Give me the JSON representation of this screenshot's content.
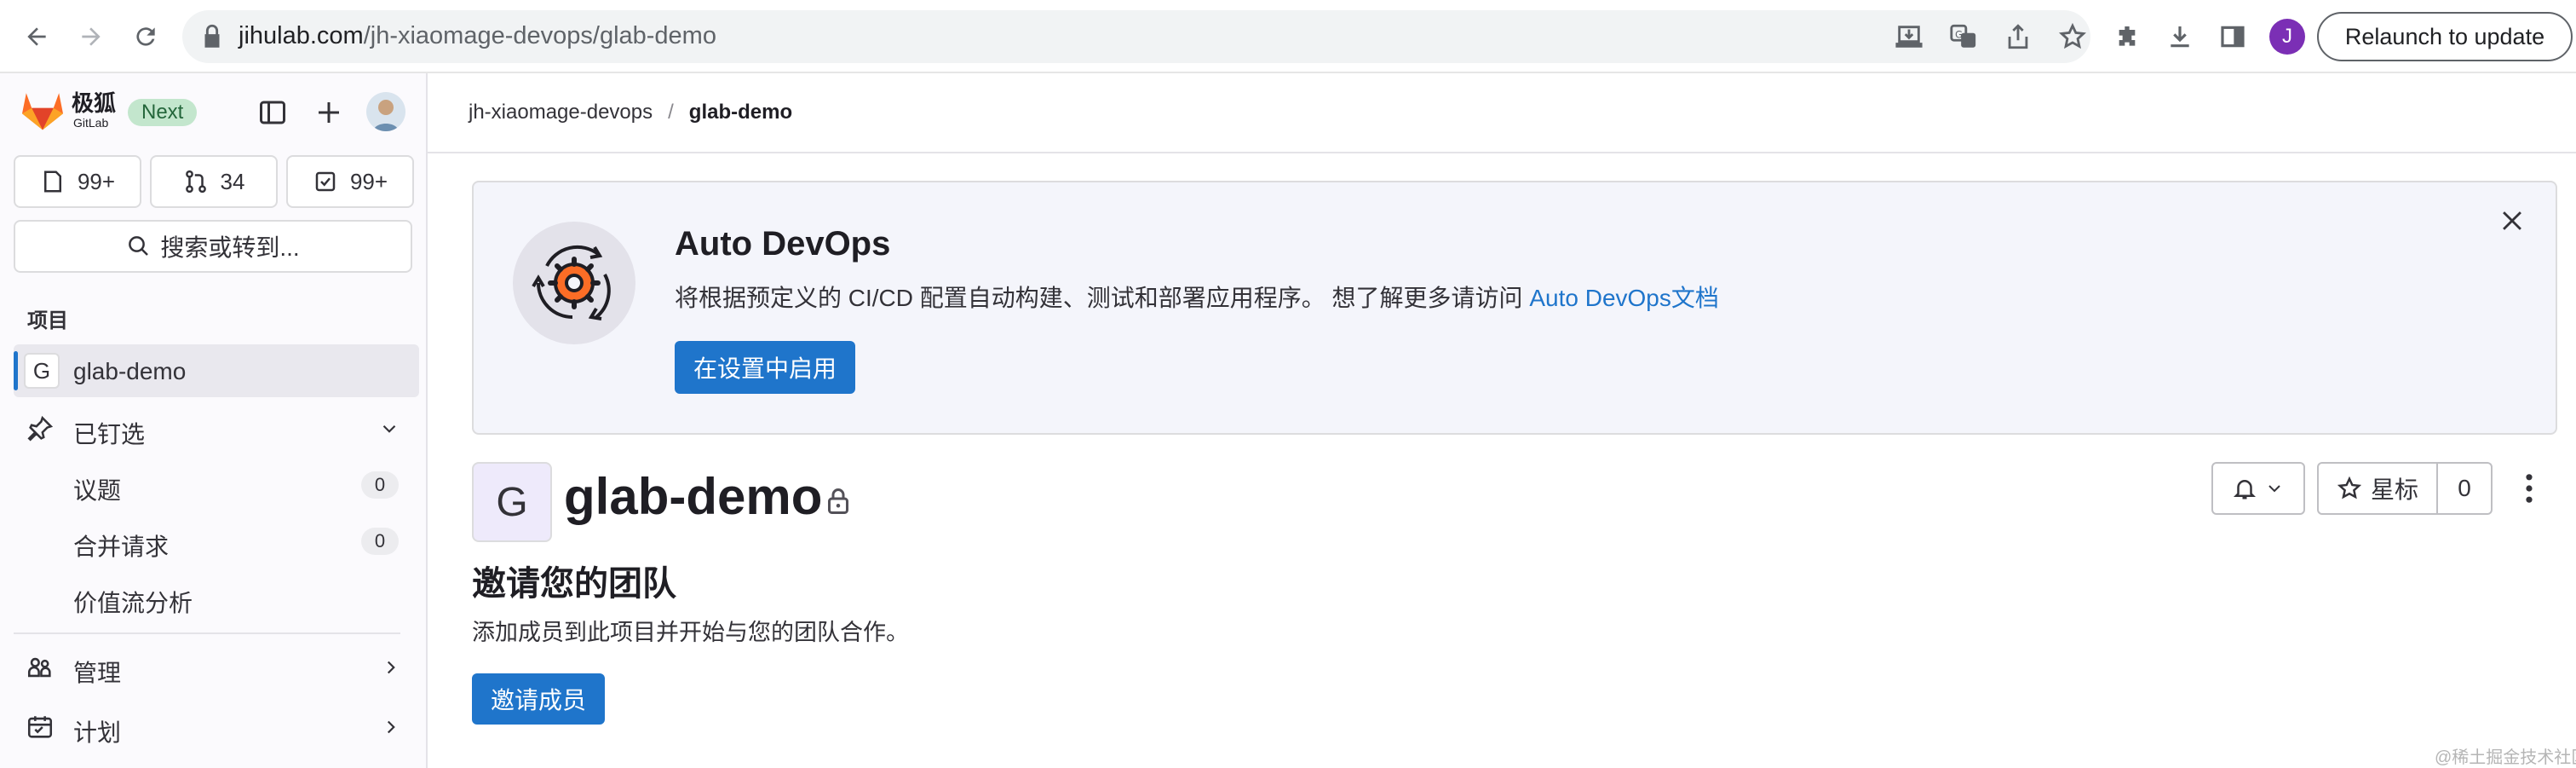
{
  "browser": {
    "url_host": "jihulab.com",
    "url_path": "/jh-xiaomage-devops/glab-demo",
    "profile_initial": "J",
    "relaunch_label": "Relaunch to update",
    "profile_color": "#7b2fb5"
  },
  "sidebar": {
    "logo_text": "极狐",
    "logo_subtext": "GitLab",
    "next_badge": "Next",
    "counts": {
      "issues": "99+",
      "merge_requests": "34",
      "todos": "99+"
    },
    "search_label": "搜索或转到...",
    "section_label": "项目",
    "project_initial": "G",
    "project_name": "glab-demo",
    "pinned_label": "已钉选",
    "pinned_items": [
      {
        "label": "议题",
        "count": "0"
      },
      {
        "label": "合并请求",
        "count": "0"
      },
      {
        "label": "价值流分析"
      }
    ],
    "manage_label": "管理",
    "plan_label": "计划"
  },
  "breadcrumb": {
    "group": "jh-xiaomage-devops",
    "separator": "/",
    "project": "glab-demo"
  },
  "devops_banner": {
    "title": "Auto DevOps",
    "description": "将根据预定义的 CI/CD 配置自动构建、测试和部署应用程序。 想了解更多请访问 ",
    "link_text": "Auto DevOps文档",
    "button_label": "在设置中启用"
  },
  "project": {
    "avatar_initial": "G",
    "title": "glab-demo",
    "star_label": "星标",
    "star_count": "0"
  },
  "invite": {
    "heading": "邀请您的团队",
    "description": "添加成员到此项目并开始与您的团队合作。",
    "button_label": "邀请成员"
  },
  "watermark": "@稀土掘金技术社区",
  "colors": {
    "accent_blue": "#1f75cb",
    "sidebar_bg": "#fbfafd",
    "banner_bg": "#f4f5fb",
    "active_item_bg": "#e9e8ee",
    "active_indicator": "#1f75cb",
    "next_badge_bg": "#c3e6cd"
  }
}
